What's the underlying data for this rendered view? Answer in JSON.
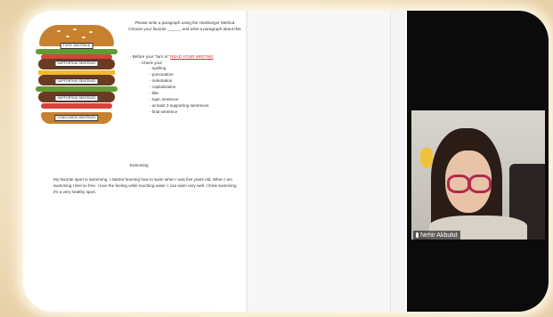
{
  "burger": {
    "labels": [
      "TOPIC SENTENCE",
      "SUPPORTING SENTENCE",
      "SUPPORTING SENTENCE",
      "SUPPORTING SENTENCE",
      "CONCLUSION SENTENCE"
    ]
  },
  "instructions": {
    "intro": "Please write a paragraph using the Hamburger Method. Choose your favorite ______ and write a paragraph about this.",
    "before_prefix": "- Before your \"turn in\"",
    "before_link": "READ YOUR WRITING",
    "check_heading": "- Check your",
    "checklist": [
      "spelling",
      "punctuation",
      "indentation",
      "capitalization",
      "title",
      "topic sentence",
      "at least 3 supporting sentences",
      "final sentence"
    ]
  },
  "essay": {
    "title": "Swimming",
    "paragraph": "My favorite sport is swimming. I started learning how to swim when I was five years old. When I am swimming I feel so free. I love the feeling while touching water. I can swim very well. I think swimming it's a very healthy sport."
  },
  "participant": {
    "name": "Nehir Akbulut"
  },
  "colors": {
    "accent_red": "#d6262a",
    "side_yellow": "#f2b600",
    "side_blue": "#3b6fd8",
    "side_green": "#34a853"
  }
}
